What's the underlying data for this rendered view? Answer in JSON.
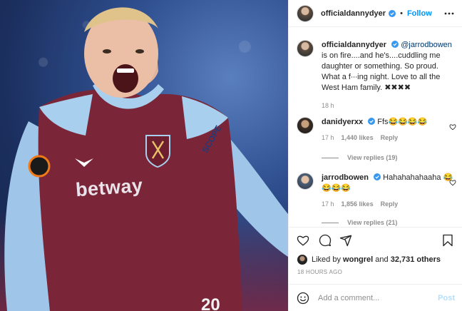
{
  "photo": {
    "shirt_sponsor": "betway",
    "sleeve_text": "SCOPE",
    "number": "20",
    "alt_subject": "footballer-celebrating"
  },
  "author": {
    "username": "officialdannydyer",
    "dot": "•",
    "follow_label": "Follow",
    "more_icon": "more-horizontal-icon"
  },
  "caption": {
    "username": "officialdannydyer",
    "mention": "@jarrodbowen",
    "text": " is on fire....and he's....cuddling me daughter or something. So proud. What a f∙∙∙ing night. Love to all the West Ham family. ✖✖✖✖",
    "age": "18 h"
  },
  "comments": [
    {
      "username": "danidyerxx",
      "text": "Ffs😂😂😂😂",
      "age": "17 h",
      "likes": "1,440 likes",
      "reply": "Reply",
      "view_replies": "View replies (19)"
    },
    {
      "username": "jarrodbowen",
      "text": "Hahahahahaaha 😂😂😂😂",
      "age": "17 h",
      "likes": "1,856 likes",
      "reply": "Reply",
      "view_replies": "View replies (21)"
    }
  ],
  "likes": {
    "prefix": "Liked by ",
    "user": "wongrel",
    "and": " and ",
    "count": "32,731 others"
  },
  "timestamp": "18 HOURS AGO",
  "composer": {
    "placeholder": "Add a comment...",
    "post_label": "Post"
  },
  "colors": {
    "accent": "#0095f6",
    "text": "#262626",
    "muted": "#8e8e8e",
    "verified": "#3897f0"
  }
}
